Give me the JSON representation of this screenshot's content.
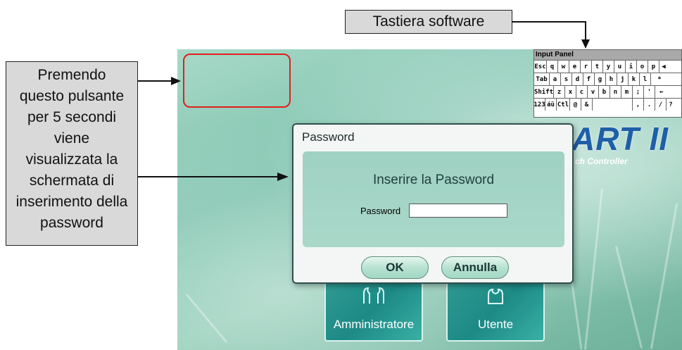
{
  "callouts": {
    "keyboard": "Tastiera software",
    "hold_button_lines": [
      "Premendo",
      "questo pulsante",
      "per 5 secondi",
      "viene",
      "visualizzata la",
      "schermata di",
      "inserimento della",
      "password"
    ]
  },
  "logo": {
    "text": "ART II",
    "subtitle": "ch Controller"
  },
  "input_panel": {
    "title": "Input Panel",
    "rows": [
      [
        "Esc",
        "q",
        "w",
        "e",
        "r",
        "t",
        "y",
        "u",
        "i",
        "o",
        "p",
        "◀"
      ],
      [
        "Tab",
        "a",
        "s",
        "d",
        "f",
        "g",
        "h",
        "j",
        "k",
        "l",
        "*"
      ],
      [
        "Shift",
        "z",
        "x",
        "c",
        "v",
        "b",
        "n",
        "m",
        ";",
        "'",
        "←"
      ],
      [
        "123",
        "áü",
        "Ctl",
        "@",
        "&",
        " ",
        ",",
        ".",
        "/",
        "?"
      ]
    ]
  },
  "dialog": {
    "title": "Password",
    "heading": "Inserire la Password",
    "field_label": "Password",
    "field_value": "",
    "ok_label": "OK",
    "cancel_label": "Annulla"
  },
  "tiles": {
    "admin_label": "Amministratore",
    "user_label": "Utente"
  },
  "colors": {
    "hotspot_border": "#e0201c",
    "logo": "#1f5fa8",
    "tile": "#2f9a92"
  }
}
